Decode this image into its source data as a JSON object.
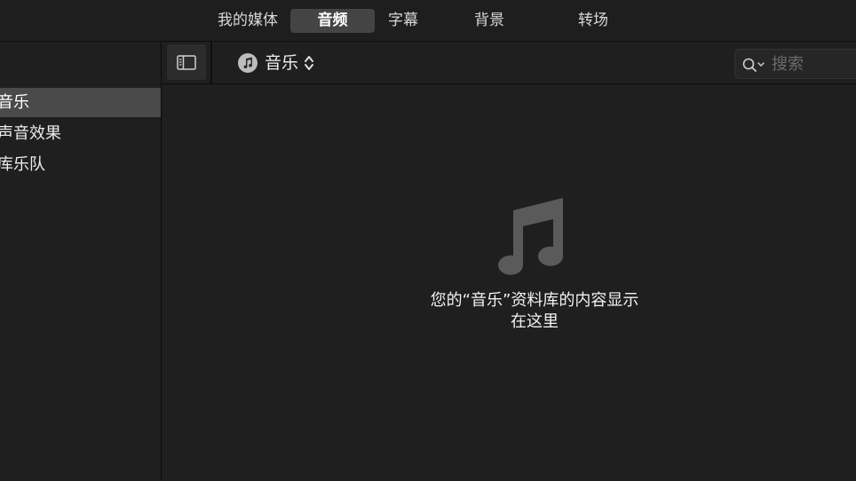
{
  "tabs": [
    {
      "label": "我的媒体",
      "active": false
    },
    {
      "label": "音频",
      "active": true
    },
    {
      "label": "字幕",
      "active": false
    },
    {
      "label": "背景",
      "active": false
    },
    {
      "label": "转场",
      "active": false
    }
  ],
  "sidebar": {
    "items": [
      {
        "label": "音乐",
        "selected": true
      },
      {
        "label": "声音效果",
        "selected": false
      },
      {
        "label": "库乐队",
        "selected": false
      }
    ]
  },
  "toolbar": {
    "source_label": "音乐",
    "search_placeholder": "搜索"
  },
  "content": {
    "empty_line1": "您的“音乐”资料库的内容显示",
    "empty_line2": "在这里"
  },
  "icons": {
    "sidebar_toggle": "sidebar-toggle-icon",
    "music_badge": "music-note-icon",
    "popup_arrows": "chevron-updown-icon",
    "search": "search-icon",
    "big_note": "music-note-icon"
  },
  "colors": {
    "background": "#1f1f1f",
    "selected_tab": "#444444",
    "selected_sidebar": "#4a4a4a"
  }
}
